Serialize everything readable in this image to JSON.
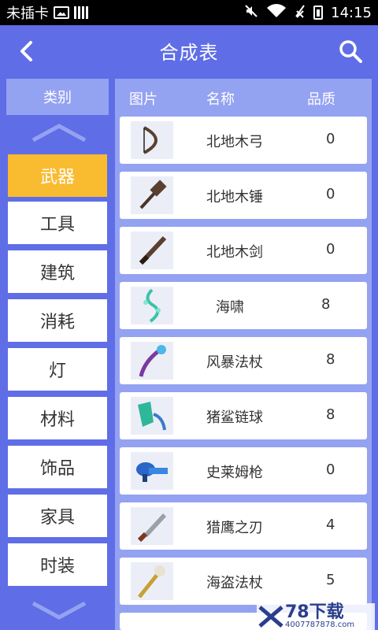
{
  "status_bar": {
    "carrier": "未插卡",
    "time": "14:15"
  },
  "header": {
    "title": "合成表",
    "back_icon": "chevron-left-icon",
    "search_icon": "search-icon"
  },
  "sidebar": {
    "header": "类别",
    "categories": [
      {
        "label": "武器",
        "active": true
      },
      {
        "label": "工具"
      },
      {
        "label": "建筑"
      },
      {
        "label": "消耗"
      },
      {
        "label": "灯"
      },
      {
        "label": "材料"
      },
      {
        "label": "饰品"
      },
      {
        "label": "家具"
      },
      {
        "label": "时装"
      }
    ]
  },
  "table": {
    "headers": {
      "image": "图片",
      "name": "名称",
      "quality": "品质"
    },
    "rows": [
      {
        "name": "北地木弓",
        "quality": "0",
        "icon": "bow-icon"
      },
      {
        "name": "北地木锤",
        "quality": "0",
        "icon": "hammer-icon"
      },
      {
        "name": "北地木剑",
        "quality": "0",
        "icon": "sword-icon"
      },
      {
        "name": "海啸",
        "quality": "8",
        "icon": "tsunami-bow-icon"
      },
      {
        "name": "风暴法杖",
        "quality": "8",
        "icon": "staff-icon"
      },
      {
        "name": "猪鲨链球",
        "quality": "8",
        "icon": "flail-icon"
      },
      {
        "name": "史莱姆枪",
        "quality": "0",
        "icon": "gun-icon"
      },
      {
        "name": "猎鹰之刃",
        "quality": "4",
        "icon": "blade-icon"
      },
      {
        "name": "海盗法杖",
        "quality": "5",
        "icon": "skull-staff-icon"
      }
    ]
  },
  "watermark": {
    "brand": "78下载",
    "url": "4007787878.com"
  },
  "colors": {
    "primary": "#5f6ee6",
    "panel": "#94a2f2",
    "active": "#f9bb2f"
  }
}
